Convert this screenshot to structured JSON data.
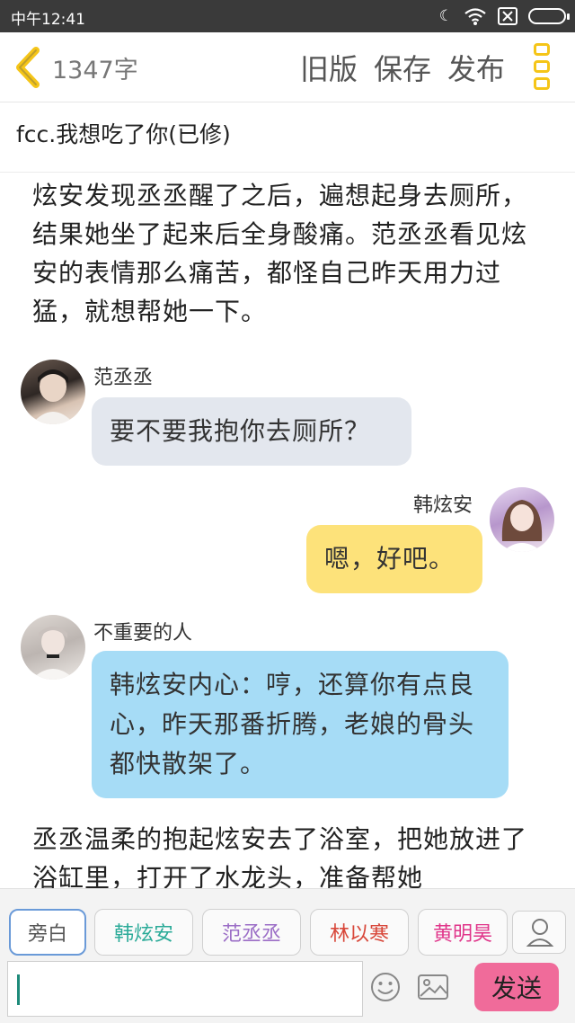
{
  "status_bar": {
    "time": "中午12:41",
    "icons": [
      "moon-icon",
      "wifi-icon",
      "sim-icon",
      "battery-icon"
    ]
  },
  "header": {
    "word_count": "1347字",
    "old_version_label": "旧版",
    "save_label": "保存",
    "publish_label": "发布"
  },
  "story": {
    "title": "fcc.我想吃了你(已修)"
  },
  "content": {
    "narration_1": "炫安发现丞丞醒了之后，遍想起身去厕所，结果她坐了起来后全身酸痛。范丞丞看见炫安的表情那么痛苦，都怪自己昨天用力过猛，就想帮她一下。",
    "messages": [
      {
        "speaker": "范丞丞",
        "side": "left",
        "text": "要不要我抱你去厕所？",
        "bubble_color": "#e3e7ee"
      },
      {
        "speaker": "韩炫安",
        "side": "right",
        "text": "嗯，好吧。",
        "bubble_color": "#fde27a"
      },
      {
        "speaker": "不重要的人",
        "side": "left",
        "text": "韩炫安内心：哼，还算你有点良心，昨天那番折腾，老娘的骨头都快散架了。",
        "bubble_color": "#a6dcf6"
      }
    ],
    "narration_2": "丞丞温柔的抱起炫安去了浴室，把她放进了浴缸里，打开了水龙头，准备帮她"
  },
  "bottom": {
    "characters": [
      {
        "label": "旁白",
        "color": "#555555",
        "selected": true
      },
      {
        "label": "韩炫安",
        "color": "#2aaa98",
        "selected": false
      },
      {
        "label": "范丞丞",
        "color": "#9b6dc6",
        "selected": false
      },
      {
        "label": "林以寒",
        "color": "#d8473a",
        "selected": false
      },
      {
        "label": "黄明昊",
        "color": "#e0358a",
        "selected": false
      }
    ],
    "input_value": "",
    "send_label": "发送"
  },
  "colors": {
    "accent_yellow": "#f5c518",
    "send_pink": "#f06b9a"
  }
}
